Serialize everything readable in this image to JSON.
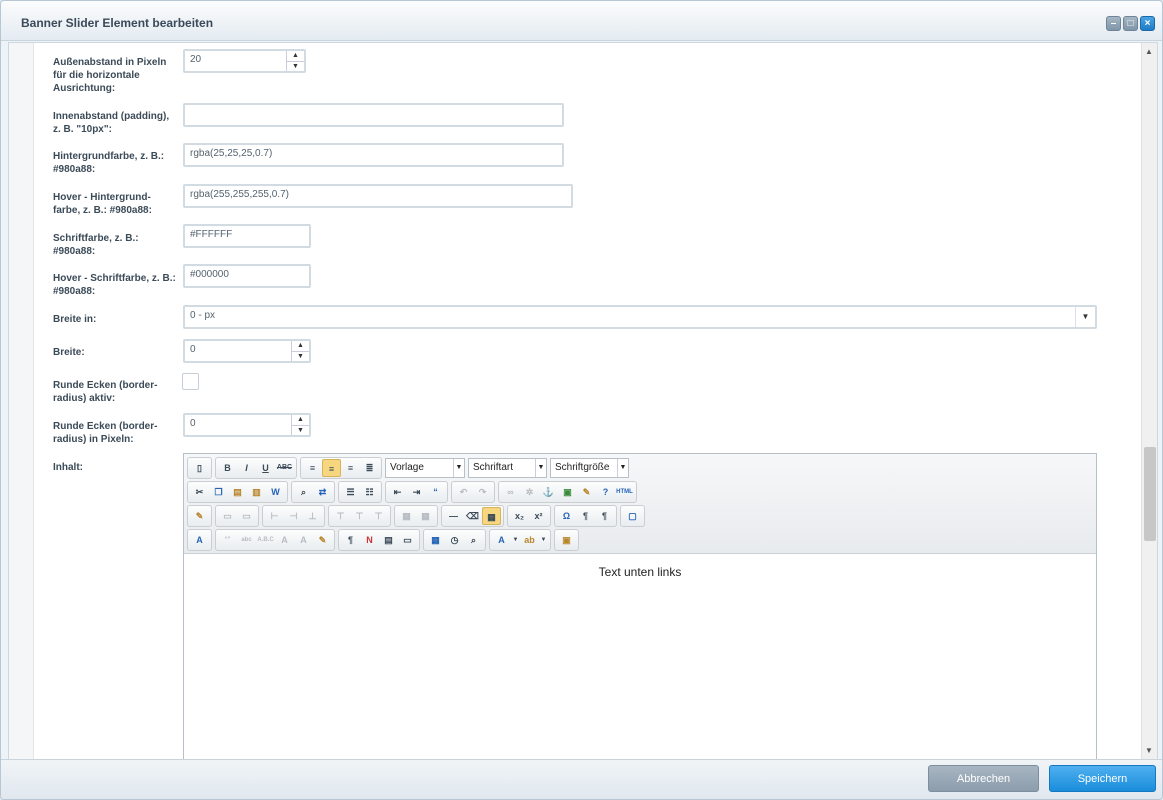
{
  "window": {
    "title": "Banner Slider Element bearbeiten"
  },
  "fields": [
    {
      "label": "Außenabstand in Pixeln für die horizontale Ausrichtung:",
      "value": "20"
    },
    {
      "label": "Innenabstand (padding), z. B. \"10px\":",
      "value": ""
    },
    {
      "label": "Hintergrundfarbe, z. B.: #980a88:",
      "value": "rgba(25,25,25,0.7)"
    },
    {
      "label": "Hover - Hintergrund-farbe, z. B.: #980a88:",
      "value": "rgba(255,255,255,0.7)"
    },
    {
      "label": "Schriftfarbe, z. B.: #980a88:",
      "value": "#FFFFFF"
    },
    {
      "label": "Hover - Schriftfarbe, z. B.: #980a88:",
      "value": "#000000"
    },
    {
      "label": "Breite in:",
      "value": "0 - px"
    },
    {
      "label": "Breite:",
      "value": "0"
    },
    {
      "label": "Runde Ecken (border-radius) aktiv:",
      "checked": false
    },
    {
      "label": "Runde Ecken (border-radius) in Pixeln:",
      "value": "0"
    },
    {
      "label": "Inhalt:"
    }
  ],
  "editor": {
    "combo_format": "Vorlage",
    "combo_font": "Schriftart",
    "combo_size": "Schriftgröße",
    "content_text": "Text unten links"
  },
  "footer": {
    "cancel": "Abbrechen",
    "save": "Speichern"
  },
  "colors": {
    "primary": "#1a8ddb",
    "secondary": "#8c9dac"
  }
}
